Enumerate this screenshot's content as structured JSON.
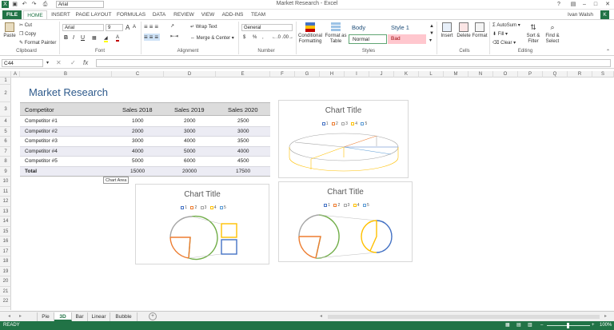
{
  "titlebar": {
    "document_title": "Market Research - Excel",
    "user": "Ivan Walsh",
    "user_initial": "K",
    "qat_font": "Arial"
  },
  "tabs": [
    "FILE",
    "HOME",
    "INSERT",
    "PAGE LAYOUT",
    "FORMULAS",
    "DATA",
    "REVIEW",
    "VIEW",
    "ADD-INS",
    "TEAM"
  ],
  "ribbon": {
    "clipboard": {
      "paste": "Paste",
      "cut": "Cut",
      "copy": "Copy",
      "format_painter": "Format Painter",
      "label": "Clipboard"
    },
    "font": {
      "name": "Arial",
      "size": "9",
      "bold": "B",
      "italic": "I",
      "underline": "U",
      "grow": "A",
      "shrink": "A",
      "label": "Font"
    },
    "alignment": {
      "wrap": "Wrap Text",
      "merge": "Merge & Center",
      "label": "Alignment"
    },
    "number": {
      "format": "General",
      "currency": "$",
      "percent": "%",
      "comma": ",",
      "label": "Number"
    },
    "styles": {
      "conditional": "Conditional Formatting",
      "format_table": "Format as Table",
      "body": "Body",
      "style1": "Style 1",
      "normal": "Normal",
      "bad": "Bad",
      "label": "Styles"
    },
    "cells": {
      "insert": "Insert",
      "delete": "Delete",
      "format": "Format",
      "label": "Cells"
    },
    "editing": {
      "autosum": "AutoSum",
      "fill": "Fill",
      "clear": "Clear",
      "sort": "Sort & Filter",
      "find": "Find & Select",
      "label": "Editing"
    }
  },
  "formula_bar": {
    "name_box": "C44",
    "fx": "fx",
    "value": ""
  },
  "columns": [
    "A",
    "B",
    "C",
    "D",
    "E",
    "F",
    "G",
    "H",
    "I",
    "J",
    "K",
    "L",
    "M",
    "N",
    "O",
    "P",
    "Q",
    "R",
    "S"
  ],
  "rows": [
    "1",
    "2",
    "3",
    "4",
    "5",
    "6",
    "7",
    "8",
    "9",
    "10",
    "11",
    "12",
    "13",
    "14",
    "15",
    "16",
    "17",
    "18",
    "19",
    "20",
    "21",
    "22"
  ],
  "sheet": {
    "title": "Market Research",
    "headers": [
      "Competitor",
      "Sales 2018",
      "Sales 2019",
      "Sales 2020"
    ],
    "rows": [
      [
        "Competitor #1",
        "1000",
        "2000",
        "2500"
      ],
      [
        "Competitor #2",
        "2000",
        "3000",
        "3000"
      ],
      [
        "Competitor #3",
        "3000",
        "4000",
        "3500"
      ],
      [
        "Competitor #4",
        "4000",
        "5000",
        "4000"
      ],
      [
        "Competitor #5",
        "5000",
        "6000",
        "4500"
      ],
      [
        "Total",
        "15000",
        "20000",
        "17500"
      ]
    ],
    "tooltip": "Chart Area"
  },
  "chart_data": [
    {
      "type": "pie",
      "title": "Chart Title",
      "legend": [
        "1",
        "2",
        "3",
        "4",
        "5"
      ],
      "values": [
        1000,
        2000,
        3000,
        4000,
        5000
      ],
      "style": "3D pie (wireframe)"
    },
    {
      "type": "pie",
      "title": "Chart Title",
      "legend": [
        "1",
        "2",
        "3",
        "4",
        "5"
      ],
      "values": [
        1000,
        2000,
        3000,
        4000,
        5000
      ],
      "style": "pie of pie"
    },
    {
      "type": "pie",
      "title": "Chart Title",
      "legend": [
        "1",
        "2",
        "3",
        "4",
        "5"
      ],
      "values": [
        1000,
        2000,
        3000,
        4000,
        5000
      ],
      "style": "bar of pie"
    }
  ],
  "series_colors": [
    "#4472c4",
    "#ed7d31",
    "#a5a5a5",
    "#ffc000",
    "#5b9bd5"
  ],
  "sheet_tabs": [
    "Pie",
    "3D",
    "Bar",
    "Linear",
    "Bubble"
  ],
  "active_sheet": "3D",
  "status": {
    "ready": "READY",
    "zoom": "100%"
  }
}
